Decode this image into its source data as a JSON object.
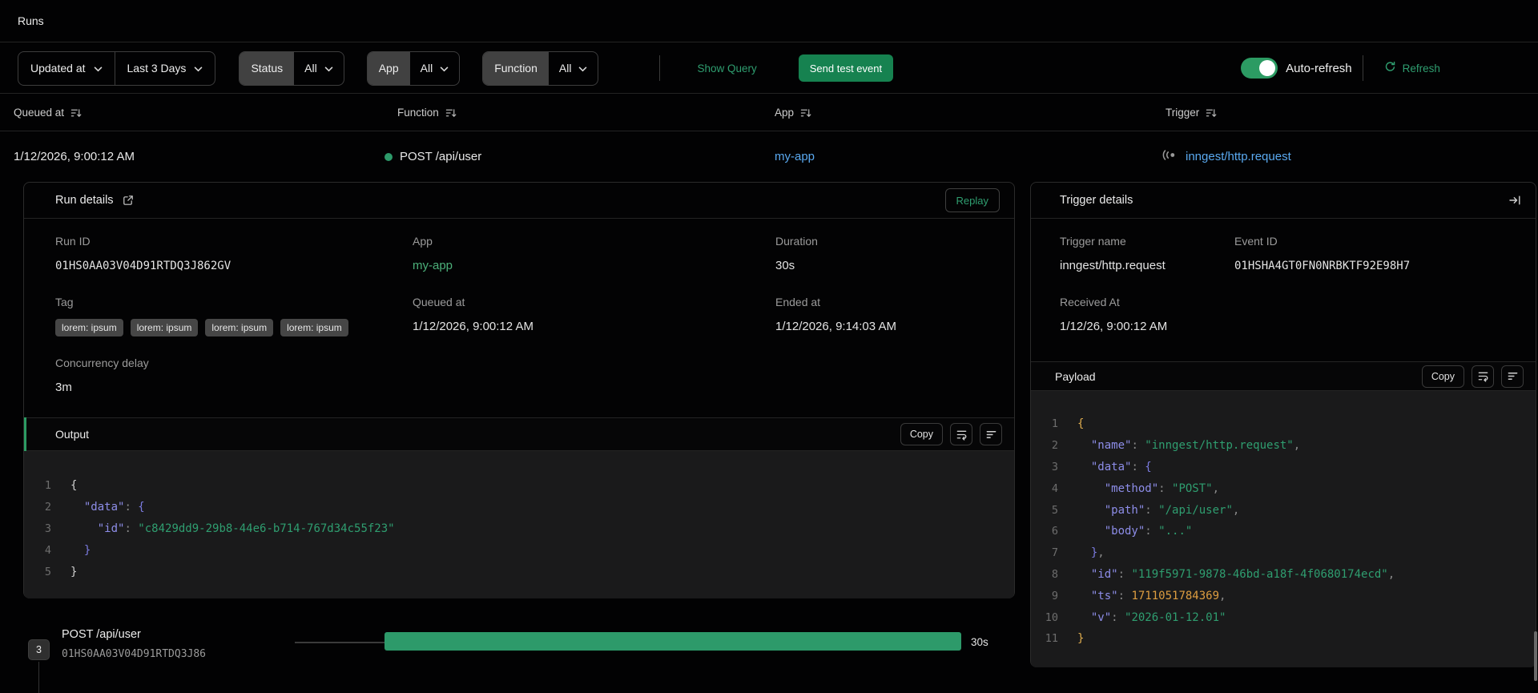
{
  "page": {
    "title": "Runs"
  },
  "filters": {
    "sort_field": "Updated at",
    "time_range": "Last 3 Days",
    "status": {
      "label": "Status",
      "value": "All"
    },
    "app": {
      "label": "App",
      "value": "All"
    },
    "function": {
      "label": "Function",
      "value": "All"
    },
    "show_query": "Show Query",
    "send_test_event": "Send test event",
    "auto_refresh_label": "Auto-refresh",
    "auto_refresh_on": true,
    "refresh_label": "Refresh"
  },
  "table": {
    "columns": [
      "Queued at",
      "Function",
      "App",
      "Trigger"
    ],
    "row": {
      "queued_at": "1/12/2026, 9:00:12 AM",
      "function": "POST /api/user",
      "app": "my-app",
      "trigger": "inngest/http.request"
    }
  },
  "run_details": {
    "title": "Run details",
    "replay_label": "Replay",
    "fields": {
      "run_id": {
        "label": "Run ID",
        "value": "01HS0AA03V04D91RTDQ3J862GV"
      },
      "app": {
        "label": "App",
        "value": "my-app"
      },
      "duration": {
        "label": "Duration",
        "value": "30s"
      },
      "tag": {
        "label": "Tag"
      },
      "queued_at": {
        "label": "Queued at",
        "value": "1/12/2026, 9:00:12 AM"
      },
      "ended_at": {
        "label": "Ended at",
        "value": "1/12/2026, 9:14:03 AM"
      },
      "concurrency_delay": {
        "label": "Concurrency delay",
        "value": "3m"
      }
    },
    "tags": [
      "lorem: ipsum",
      "lorem: ipsum",
      "lorem: ipsum",
      "lorem: ipsum"
    ],
    "output": {
      "title": "Output",
      "copy_label": "Copy",
      "lines": [
        {
          "n": "1",
          "toks": [
            [
              "w",
              "{"
            ]
          ]
        },
        {
          "n": "2",
          "toks": [
            [
              "k",
              "  \"data\""
            ],
            [
              "p",
              ": "
            ],
            [
              "b1",
              "{"
            ]
          ]
        },
        {
          "n": "3",
          "toks": [
            [
              "k",
              "    \"id\""
            ],
            [
              "p",
              ": "
            ],
            [
              "s",
              "\"c8429dd9-29b8-44e6-b714-767d34c55f23\""
            ]
          ]
        },
        {
          "n": "4",
          "toks": [
            [
              "b1",
              "  }"
            ]
          ]
        },
        {
          "n": "5",
          "toks": [
            [
              "w",
              "}"
            ]
          ]
        }
      ]
    }
  },
  "trigger_details": {
    "title": "Trigger details",
    "fields": {
      "trigger_name": {
        "label": "Trigger name",
        "value": "inngest/http.request"
      },
      "event_id": {
        "label": "Event ID",
        "value": "01HSHA4GT0FN0NRBKTF92E98H7"
      },
      "received_at": {
        "label": "Received At",
        "value": "1/12/26, 9:00:12 AM"
      }
    },
    "payload": {
      "title": "Payload",
      "copy_label": "Copy",
      "lines": [
        {
          "n": "1",
          "toks": [
            [
              "b0",
              "{"
            ]
          ]
        },
        {
          "n": "2",
          "toks": [
            [
              "k",
              "  \"name\""
            ],
            [
              "p",
              ": "
            ],
            [
              "s",
              "\"inngest/http.request\""
            ],
            [
              "p",
              ","
            ]
          ]
        },
        {
          "n": "3",
          "toks": [
            [
              "k",
              "  \"data\""
            ],
            [
              "p",
              ": "
            ],
            [
              "b1",
              "{"
            ]
          ]
        },
        {
          "n": "4",
          "toks": [
            [
              "k",
              "    \"method\""
            ],
            [
              "p",
              ": "
            ],
            [
              "s",
              "\"POST\""
            ],
            [
              "p",
              ","
            ]
          ]
        },
        {
          "n": "5",
          "toks": [
            [
              "k",
              "    \"path\""
            ],
            [
              "p",
              ": "
            ],
            [
              "s",
              "\"/api/user\""
            ],
            [
              "p",
              ","
            ]
          ]
        },
        {
          "n": "6",
          "toks": [
            [
              "k",
              "    \"body\""
            ],
            [
              "p",
              ": "
            ],
            [
              "s",
              "\"...\""
            ]
          ]
        },
        {
          "n": "7",
          "toks": [
            [
              "b1",
              "  }"
            ],
            [
              "p",
              ","
            ]
          ]
        },
        {
          "n": "8",
          "toks": [
            [
              "k",
              "  \"id\""
            ],
            [
              "p",
              ": "
            ],
            [
              "s",
              "\"119f5971-9878-46bd-a18f-4f0680174ecd\""
            ],
            [
              "p",
              ","
            ]
          ]
        },
        {
          "n": "9",
          "toks": [
            [
              "k",
              "  \"ts\""
            ],
            [
              "p",
              ": "
            ],
            [
              "n",
              "1711051784369"
            ],
            [
              "p",
              ","
            ]
          ]
        },
        {
          "n": "10",
          "toks": [
            [
              "k",
              "  \"v\""
            ],
            [
              "p",
              ": "
            ],
            [
              "s",
              "\"2026-01-12.01\""
            ]
          ]
        },
        {
          "n": "11",
          "toks": [
            [
              "b0",
              "}"
            ]
          ]
        }
      ]
    }
  },
  "timeline": {
    "count": "3",
    "step_name": "POST /api/user",
    "step_id": "01HS0AA03V04D91RTDQ3J86",
    "duration": "30s"
  },
  "colors": {
    "accent_green": "#2c9b63",
    "green_text": "#2f9e70",
    "button_green": "#168250",
    "bar_green": "#2d9a6a",
    "link_blue": "#5aa9f0",
    "key_purple": "#8d8de8",
    "string_green": "#2f9e70",
    "number_orange": "#dd9d40"
  }
}
